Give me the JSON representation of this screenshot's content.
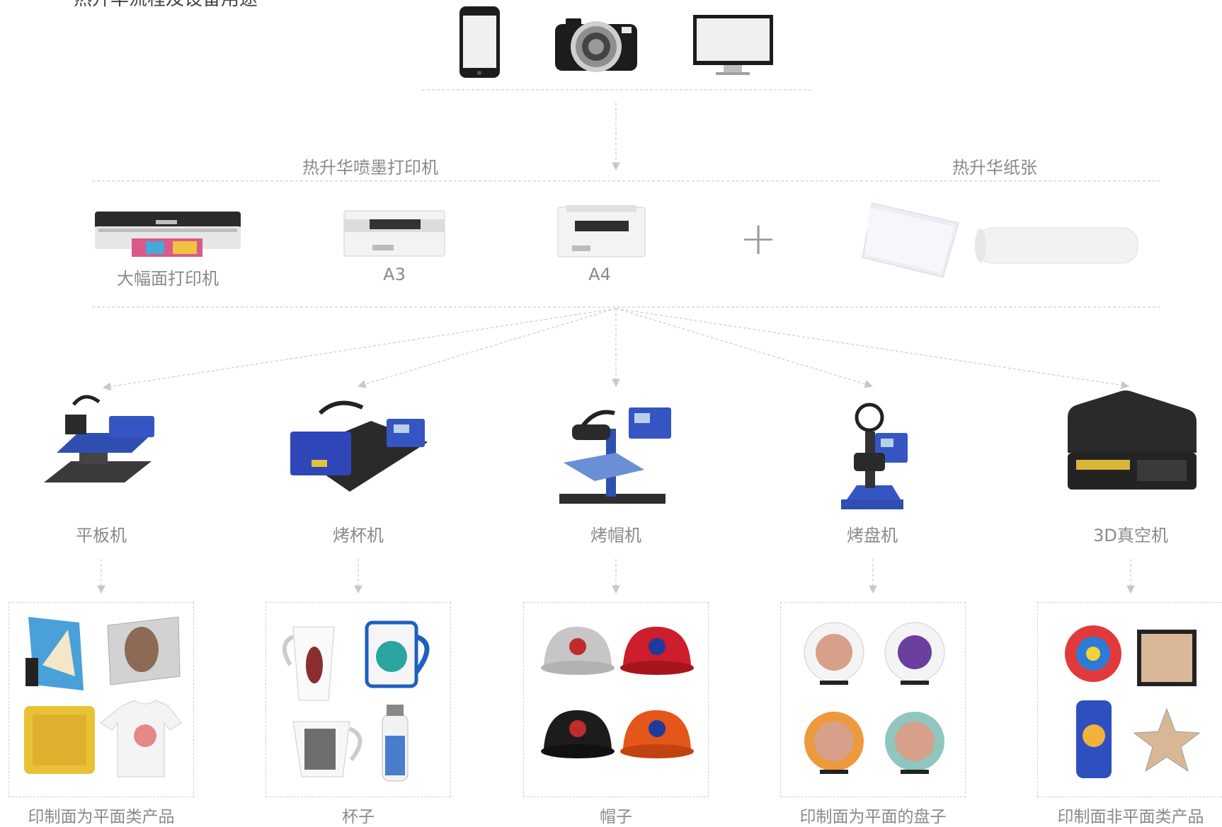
{
  "title": "热升华流程及设备用途",
  "sections": {
    "printers_label": "热升华喷墨打印机",
    "paper_label": "热升华纸张"
  },
  "plus": "+",
  "printers": [
    {
      "label": "大幅面打印机",
      "icon": "large-format-printer"
    },
    {
      "label": "A3",
      "icon": "desktop-printer"
    },
    {
      "label": "A4",
      "icon": "desktop-printer"
    }
  ],
  "papers": [
    {
      "icon": "paper-sheets"
    },
    {
      "icon": "paper-roll"
    }
  ],
  "devices": [
    {
      "icon": "phone"
    },
    {
      "icon": "camera"
    },
    {
      "icon": "monitor"
    }
  ],
  "machines": [
    {
      "label": "平板机",
      "icon": "flat-heat-press"
    },
    {
      "label": "烤杯机",
      "icon": "mug-press"
    },
    {
      "label": "烤帽机",
      "icon": "cap-press"
    },
    {
      "label": "烤盘机",
      "icon": "plate-press"
    },
    {
      "label": "3D真空机",
      "icon": "3d-vacuum-machine"
    }
  ],
  "products": [
    {
      "label": "印制面为平面类产品",
      "items": [
        "photo-panel",
        "photo-slate",
        "pillow",
        "tshirt"
      ]
    },
    {
      "label": "杯子",
      "items": [
        "latte-mug",
        "blue-mug",
        "conical-mug",
        "water-bottle"
      ]
    },
    {
      "label": "帽子",
      "items": [
        "gray-cap",
        "red-cap",
        "black-cap",
        "orange-cap"
      ]
    },
    {
      "label": "印制面为平面的盘子",
      "items": [
        "plate",
        "plate",
        "plate",
        "plate"
      ]
    },
    {
      "label": "印制面非平面类产品",
      "items": [
        "round-plate",
        "photo-frame",
        "phone-case",
        "star-ornament"
      ]
    }
  ]
}
